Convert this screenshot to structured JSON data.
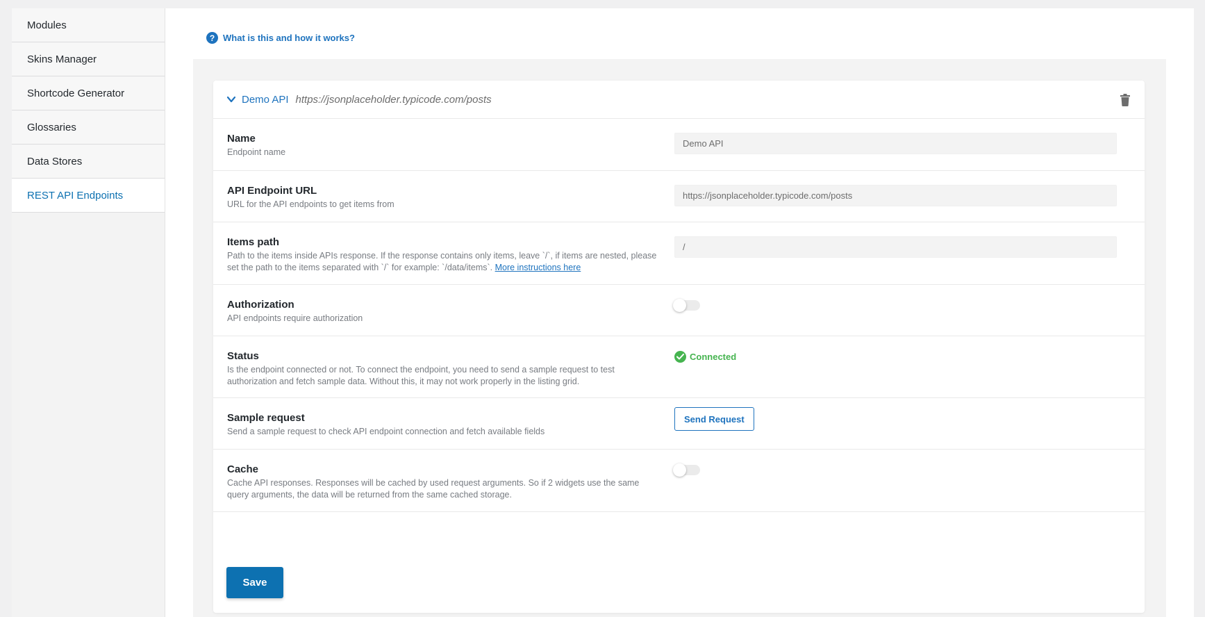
{
  "sidebar": {
    "items": [
      {
        "label": "Modules",
        "active": false
      },
      {
        "label": "Skins Manager",
        "active": false
      },
      {
        "label": "Shortcode Generator",
        "active": false
      },
      {
        "label": "Glossaries",
        "active": false
      },
      {
        "label": "Data Stores",
        "active": false
      },
      {
        "label": "REST API Endpoints",
        "active": true
      }
    ]
  },
  "help": {
    "icon": "question-icon",
    "label": "What is this and how it works?"
  },
  "endpoint": {
    "title": "Demo API",
    "url": "https://jsonplaceholder.typicode.com/posts",
    "fields": {
      "name": {
        "title": "Name",
        "desc": "Endpoint name",
        "value": "Demo API"
      },
      "url": {
        "title": "API Endpoint URL",
        "desc": "URL for the API endpoints to get items from",
        "value": "https://jsonplaceholder.typicode.com/posts"
      },
      "items_path": {
        "title": "Items path",
        "desc": "Path to the items inside APIs response. If the response contains only items, leave `/`, if items are nested, please set the path to the items separated with `/` for example: `/data/items`.",
        "link": "More instructions here",
        "value": "/"
      },
      "authorization": {
        "title": "Authorization",
        "desc": "API endpoints require authorization",
        "enabled": false
      },
      "status": {
        "title": "Status",
        "desc": "Is the endpoint connected or not. To connect the endpoint, you need to send a sample request to test authorization and fetch sample data. Without this, it may not work properly in the listing grid.",
        "value": "Connected"
      },
      "sample_request": {
        "title": "Sample request",
        "desc": "Send a sample request to check API endpoint connection and fetch available fields",
        "button": "Send Request"
      },
      "cache": {
        "title": "Cache",
        "desc": "Cache API responses. Responses will be cached by used request arguments. So if 2 widgets use the same query arguments, the data will be returned from the same cached storage.",
        "enabled": false
      }
    },
    "save_label": "Save"
  },
  "colors": {
    "accent": "#1e73be",
    "save": "#0d71b1",
    "success": "#46b450"
  }
}
